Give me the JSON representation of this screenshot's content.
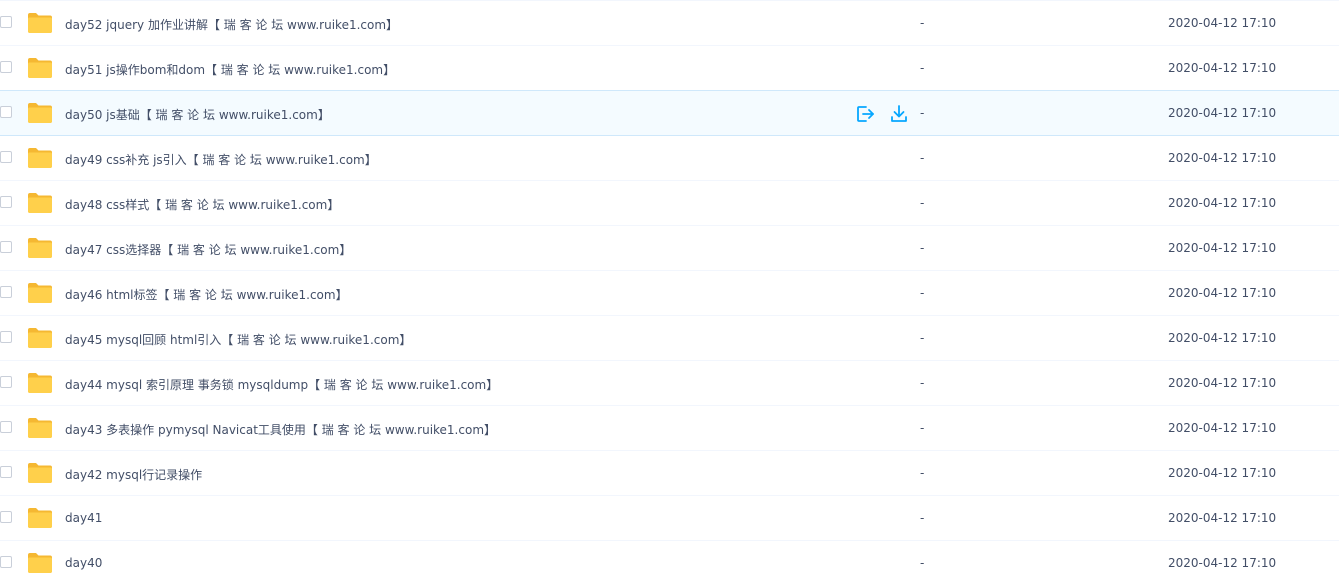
{
  "rows": [
    {
      "name": "day52 jquery 加作业讲解【 瑞 客 论 坛 www.ruike1.com】",
      "size": "-",
      "modified": "2020-04-12 17:10"
    },
    {
      "name": "day51 js操作bom和dom【 瑞 客 论 坛 www.ruike1.com】",
      "size": "-",
      "modified": "2020-04-12 17:10"
    },
    {
      "name": "day50 js基础【 瑞 客 论 坛 www.ruike1.com】",
      "size": "-",
      "modified": "2020-04-12 17:10",
      "hovered": true
    },
    {
      "name": "day49 css补充 js引入【 瑞 客 论 坛 www.ruike1.com】",
      "size": "-",
      "modified": "2020-04-12 17:10"
    },
    {
      "name": "day48 css样式【 瑞 客 论 坛 www.ruike1.com】",
      "size": "-",
      "modified": "2020-04-12 17:10"
    },
    {
      "name": "day47 css选择器【 瑞 客 论 坛 www.ruike1.com】",
      "size": "-",
      "modified": "2020-04-12 17:10"
    },
    {
      "name": "day46 html标签【 瑞 客 论 坛 www.ruike1.com】",
      "size": "-",
      "modified": "2020-04-12 17:10"
    },
    {
      "name": "day45 mysql回顾 html引入【 瑞 客 论 坛 www.ruike1.com】",
      "size": "-",
      "modified": "2020-04-12 17:10"
    },
    {
      "name": "day44 mysql 索引原理 事务锁 mysqldump【 瑞 客 论 坛 www.ruike1.com】",
      "size": "-",
      "modified": "2020-04-12 17:10"
    },
    {
      "name": "day43 多表操作 pymysql Navicat工具使用【 瑞 客 论 坛 www.ruike1.com】",
      "size": "-",
      "modified": "2020-04-12 17:10"
    },
    {
      "name": "day42 mysql行记录操作",
      "size": "-",
      "modified": "2020-04-12 17:10"
    },
    {
      "name": "day41",
      "size": "-",
      "modified": "2020-04-12 17:10"
    },
    {
      "name": "day40",
      "size": "-",
      "modified": "2020-04-12 17:10"
    }
  ],
  "icons": {
    "folder": "folder-icon",
    "share": "share-icon",
    "download": "download-icon"
  },
  "colors": {
    "folder": "#ffd04b",
    "folder_tab": "#f5b832",
    "action": "#06a7ff",
    "hover_bg": "#f4fbff",
    "text": "#424e67"
  }
}
